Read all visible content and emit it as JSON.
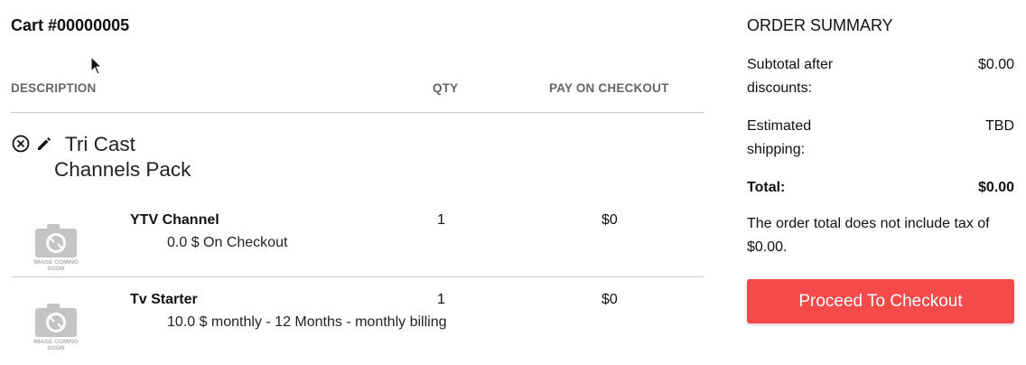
{
  "cart": {
    "title": "Cart #00000005"
  },
  "table": {
    "headers": {
      "description": "DESCRIPTION",
      "qty": "QTY",
      "pay": "PAY ON CHECKOUT"
    }
  },
  "bundle": {
    "name_line1": "Tri Cast",
    "name_line2": "Channels Pack"
  },
  "items": [
    {
      "name": "YTV Channel",
      "description": "0.0 $ On Checkout",
      "qty": "1",
      "pay": "$0",
      "image_caption": "IMAGE COMING SOON"
    },
    {
      "name": "Tv Starter",
      "description": "10.0 $ monthly - 12 Months - monthly billing",
      "qty": "1",
      "pay": "$0",
      "image_caption": "IMAGE COMING SOON"
    }
  ],
  "summary": {
    "title": "ORDER SUMMARY",
    "subtotal_label": "Subtotal after discounts:",
    "subtotal_value": "$0.00",
    "shipping_label": "Estimated shipping:",
    "shipping_value": "TBD",
    "total_label": "Total:",
    "total_value": "$0.00",
    "tax_note": "The order total does not include tax of $0.00."
  },
  "actions": {
    "checkout_label": "Proceed To Checkout"
  },
  "colors": {
    "checkout_button": "#f44a4a",
    "header_text": "#666666",
    "divider": "#c8c8c8"
  },
  "icons": {
    "remove": "circle-x-icon",
    "edit": "pencil-icon",
    "placeholder": "camera-placeholder-icon",
    "pointer": "mouse-pointer-icon"
  }
}
